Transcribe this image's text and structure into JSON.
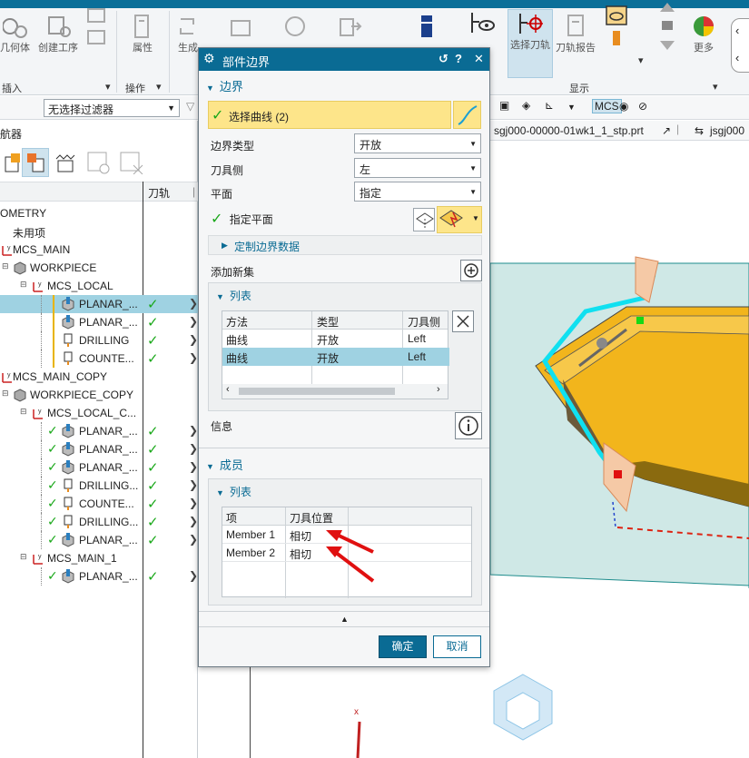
{
  "ribbon": {
    "buttons": [
      "几何体",
      "创建工序",
      "属性",
      "生成",
      "选择刀轨",
      "刀轨报告",
      "更多"
    ],
    "group_labels": [
      "插入",
      "操作",
      "显示"
    ]
  },
  "filterbar": {
    "filter_value": "无选择过滤器"
  },
  "navigator": {
    "title": "航器",
    "column_path": "刀轨",
    "rows": [
      {
        "label": "OMETRY",
        "indent": 0
      },
      {
        "label": "未用项",
        "indent": 0
      },
      {
        "label": "MCS_MAIN",
        "indent": 1
      },
      {
        "label": "WORKPIECE",
        "indent": 2
      },
      {
        "label": "MCS_LOCAL",
        "indent": 3
      },
      {
        "label": "PLANAR_...",
        "indent": 4
      },
      {
        "label": "PLANAR_...",
        "indent": 4
      },
      {
        "label": "DRILLING",
        "indent": 4
      },
      {
        "label": "COUNTE...",
        "indent": 4
      },
      {
        "label": "MCS_MAIN_COPY",
        "indent": 1
      },
      {
        "label": "WORKPIECE_COPY",
        "indent": 2
      },
      {
        "label": "MCS_LOCAL_C...",
        "indent": 3
      },
      {
        "label": "PLANAR_...",
        "indent": 4
      },
      {
        "label": "PLANAR_...",
        "indent": 4
      },
      {
        "label": "PLANAR_...",
        "indent": 4
      },
      {
        "label": "DRILLING...",
        "indent": 4
      },
      {
        "label": "COUNTE...",
        "indent": 4
      },
      {
        "label": "DRILLING...",
        "indent": 4
      },
      {
        "label": "PLANAR_...",
        "indent": 4
      },
      {
        "label": "MCS_MAIN_1",
        "indent": 3
      },
      {
        "label": "PLANAR_...",
        "indent": 4
      }
    ]
  },
  "graphics": {
    "tab1": "sgj000-00000-01wk1_1_stp.prt",
    "tab2": "jsgj000"
  },
  "dialog": {
    "title": "部件边界",
    "boundary_section": "边界",
    "select_curve": "选择曲线 (2)",
    "boundary_type_label": "边界类型",
    "boundary_type_value": "开放",
    "tool_side_label": "刀具侧",
    "tool_side_value": "左",
    "plane_label": "平面",
    "plane_value": "指定",
    "specify_plane": "指定平面",
    "custom_data": "定制边界数据",
    "add_new_set": "添加新集",
    "list_section": "列表",
    "list_headers": [
      "方法",
      "类型",
      "刀具侧"
    ],
    "list_rows": [
      [
        "曲线",
        "开放",
        "Left"
      ],
      [
        "曲线",
        "开放",
        "Left"
      ]
    ],
    "info_label": "信息",
    "members_section": "成员",
    "members_list": "列表",
    "member_headers": [
      "项",
      "刀具位置"
    ],
    "member_rows": [
      [
        "Member 1",
        "相切"
      ],
      [
        "Member 2",
        "相切"
      ]
    ],
    "ok": "确定",
    "cancel": "取消"
  }
}
